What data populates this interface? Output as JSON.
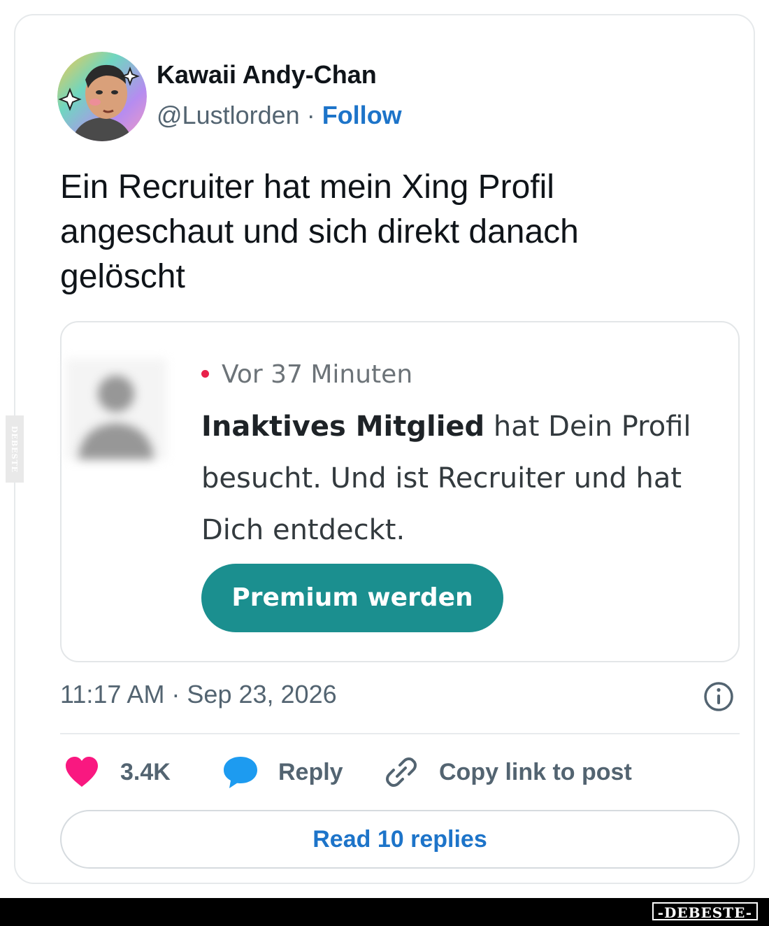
{
  "author": {
    "name": "Kawaii Andy-Chan",
    "handle": "@Lustlorden",
    "separator": "·",
    "follow_label": "Follow"
  },
  "tweet": {
    "text": "Ein Recruiter hat mein Xing Profil angeschaut und sich direkt danach gelöscht"
  },
  "embedded_notification": {
    "time": "Vor 37 Minuten",
    "member": "Inaktives Mitglied",
    "message": " hat Dein Profil besucht. Und ist Recruiter und hat Dich entdeckt.",
    "button_label": "Premium werden",
    "accent_color": "#1b8f8f"
  },
  "meta": {
    "timestamp": "11:17 AM · Sep 23, 2026"
  },
  "actions": {
    "like_count": "3.4K",
    "reply_label": "Reply",
    "copy_label": "Copy link to post"
  },
  "read_replies_label": "Read 10 replies",
  "watermark": {
    "side": "DEBESTE",
    "footer": "-DEBESTE-"
  },
  "colors": {
    "link_blue": "#1d74c9",
    "like_pink": "#f91880",
    "reply_blue": "#1d9bf0",
    "muted_text": "#536471"
  }
}
